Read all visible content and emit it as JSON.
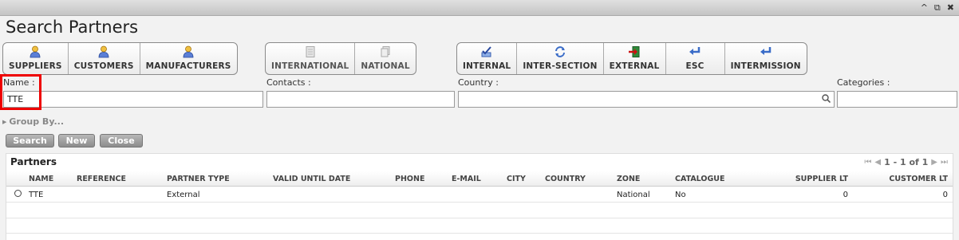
{
  "window": {
    "controls": [
      "^",
      "⧉",
      "✖"
    ]
  },
  "page": {
    "title": "Search Partners"
  },
  "toolbar": {
    "group1": [
      {
        "label": "SUPPLIERS",
        "icon": "person-icon"
      },
      {
        "label": "CUSTOMERS",
        "icon": "person-icon"
      },
      {
        "label": "MANUFACTURERS",
        "icon": "person-icon"
      }
    ],
    "group2": [
      {
        "label": "INTERNATIONAL",
        "icon": "document-icon"
      },
      {
        "label": "NATIONAL",
        "icon": "document-icon"
      }
    ],
    "group3": [
      {
        "label": "INTERNAL",
        "icon": "checkmark-edit-icon"
      },
      {
        "label": "INTER-SECTION",
        "icon": "refresh-icon"
      },
      {
        "label": "EXTERNAL",
        "icon": "exit-icon"
      },
      {
        "label": "ESC",
        "icon": "return-arrow-icon"
      },
      {
        "label": "INTERMISSION",
        "icon": "return-arrow-icon"
      }
    ]
  },
  "filters": {
    "name_label": "Name :",
    "name_value": "TTE",
    "contacts_label": "Contacts :",
    "contacts_value": "",
    "country_label": "Country :",
    "country_value": "",
    "categories_label": "Categories :",
    "categories_value": ""
  },
  "group_by": "Group By...",
  "actions": {
    "search": "Search",
    "new": "New",
    "close": "Close"
  },
  "results": {
    "title": "Partners",
    "pager": "1 - 1 of 1",
    "columns": [
      "NAME",
      "REFERENCE",
      "PARTNER TYPE",
      "VALID UNTIL DATE",
      "PHONE",
      "E-MAIL",
      "CITY",
      "COUNTRY",
      "ZONE",
      "CATALOGUE",
      "SUPPLIER LT",
      "CUSTOMER LT"
    ],
    "rows": [
      {
        "name": "TTE",
        "reference": "",
        "partner_type": "External",
        "valid_until": "",
        "phone": "",
        "email": "",
        "city": "",
        "country": "",
        "zone": "National",
        "catalogue": "No",
        "supplier_lt": "0",
        "customer_lt": "0"
      }
    ]
  },
  "colors": {
    "highlight": "#ee0000",
    "button_gray": "#9a9a9a"
  }
}
